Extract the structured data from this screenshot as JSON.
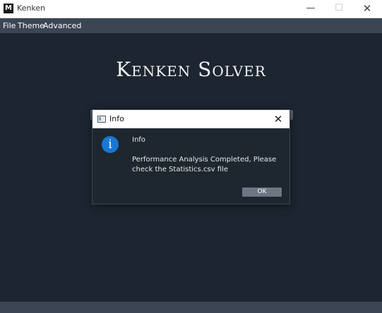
{
  "window": {
    "title": "Kenken",
    "app_icon_letter": "M",
    "controls": {
      "minimize": "—",
      "maximize": "☐",
      "close": "✕"
    }
  },
  "menubar": {
    "items": [
      {
        "label": "File"
      },
      {
        "label": "Theme"
      },
      {
        "label": "Advanced"
      }
    ]
  },
  "main": {
    "title": "Kenken Solver"
  },
  "dialog": {
    "title": "Info",
    "close_glyph": "✕",
    "icon_glyph": "i",
    "heading": "Info",
    "message": "Performance Analysis Completed, Please check the Statistics.csv file",
    "ok_label": "OK"
  },
  "colors": {
    "background": "#1c2530",
    "menubar": "#3b4553",
    "info_icon": "#1877d4",
    "ok_button": "#6c7684"
  }
}
